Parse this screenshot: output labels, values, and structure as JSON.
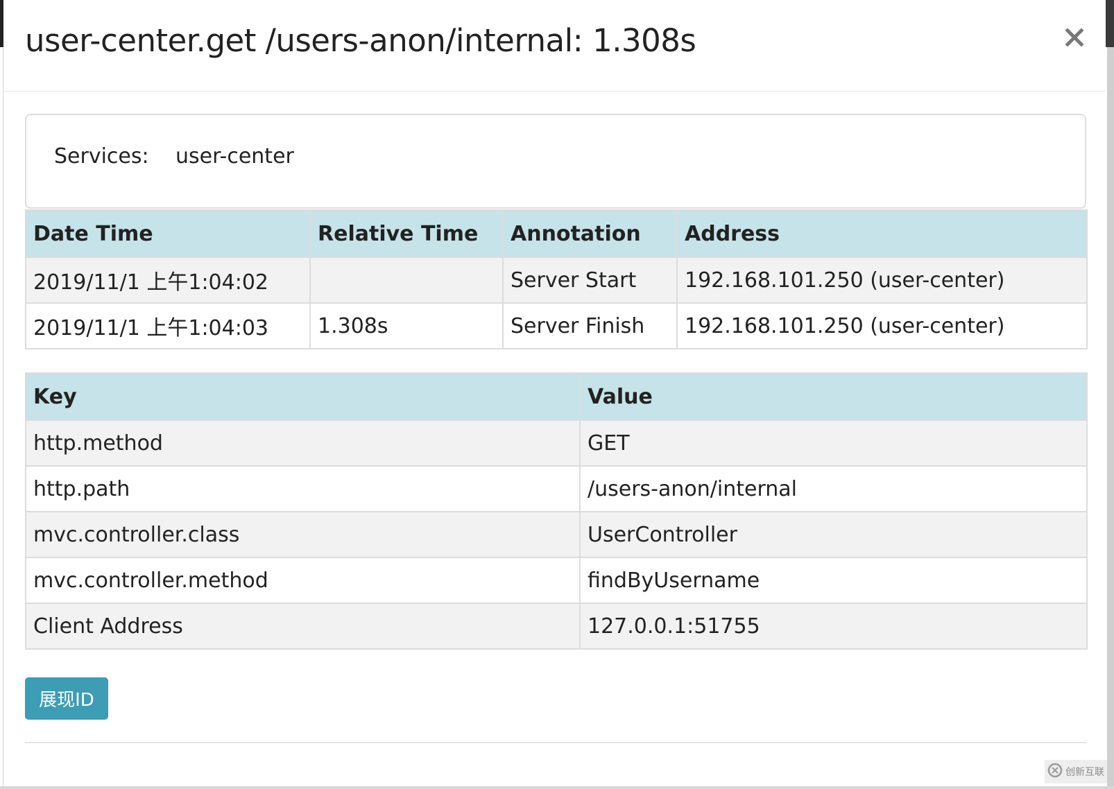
{
  "modal": {
    "title": "user-center.get /users-anon/internal: 1.308s",
    "close_icon": "close-icon"
  },
  "services": {
    "label": "Services:",
    "value": "user-center"
  },
  "annotations": {
    "headers": [
      "Date Time",
      "Relative Time",
      "Annotation",
      "Address"
    ],
    "rows": [
      [
        "2019/11/1 上午1:04:02",
        "",
        "Server Start",
        "192.168.101.250 (user-center)"
      ],
      [
        "2019/11/1 上午1:04:03",
        "1.308s",
        "Server Finish",
        "192.168.101.250 (user-center)"
      ]
    ]
  },
  "tags": {
    "headers": [
      "Key",
      "Value"
    ],
    "rows": [
      [
        "http.method",
        "GET"
      ],
      [
        "http.path",
        "/users-anon/internal"
      ],
      [
        "mvc.controller.class",
        "UserController"
      ],
      [
        "mvc.controller.method",
        "findByUsername"
      ],
      [
        "Client Address",
        "127.0.0.1:51755"
      ]
    ]
  },
  "footer": {
    "show_id_label": "展现ID"
  },
  "watermark": {
    "text": "创新互联",
    "icon": "logo-icon"
  },
  "colors": {
    "header_bg": "#c7e3ea",
    "button_bg": "#3c9db4",
    "stripe_bg": "#f2f2f2"
  }
}
